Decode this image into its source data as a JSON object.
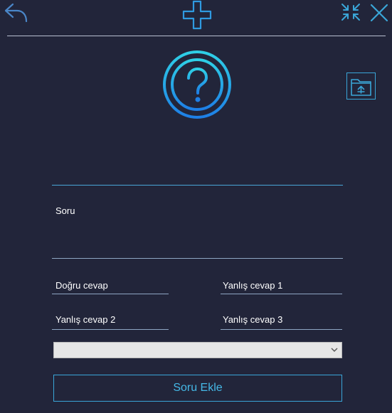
{
  "toolbar": {
    "back_icon": "back-arrow-icon",
    "add_icon": "plus-icon",
    "minimize_icon": "collapse-icon",
    "close_icon": "close-icon"
  },
  "form": {
    "question_label": "Soru",
    "correct_answer_label": "Doğru cevap",
    "wrong_answer_1_label": "Yanlış cevap 1",
    "wrong_answer_2_label": "Yanlış cevap 2",
    "wrong_answer_3_label": "Yanlış cevap 3",
    "category_select_value": "",
    "submit_label": "Soru Ekle"
  },
  "colors": {
    "background": "#22253a",
    "accent": "#3aa6d8",
    "accent_text": "#45b8e6",
    "text": "#ffffff"
  }
}
